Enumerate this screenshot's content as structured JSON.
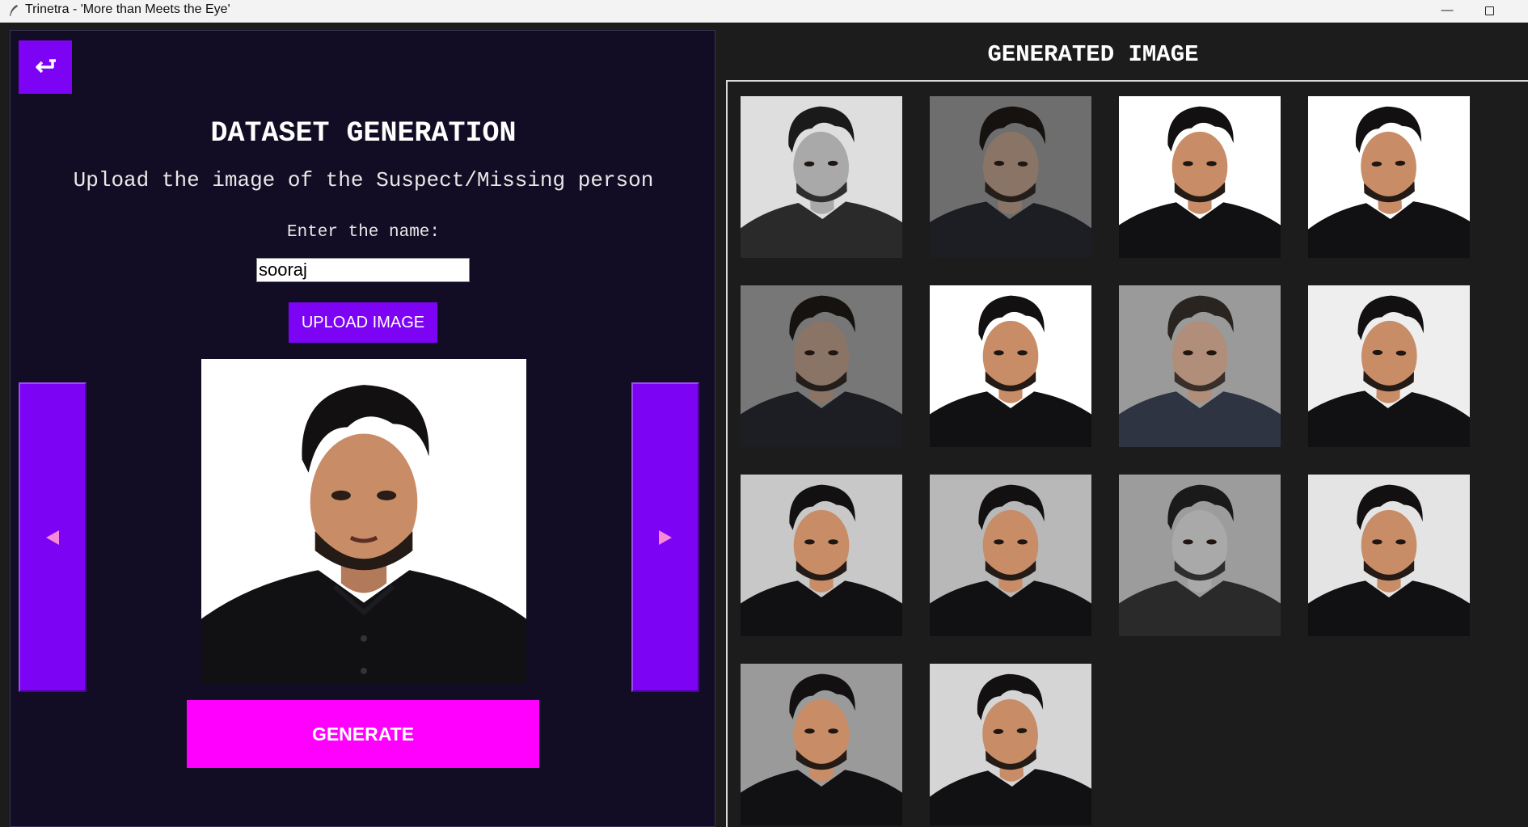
{
  "window": {
    "title": "Trinetra - 'More than Meets the Eye'",
    "minimize_glyph": "—"
  },
  "left": {
    "back_icon": "return-arrow-icon",
    "heading": "DATASET GENERATION",
    "subheading": "Upload the image of the Suspect/Missing person",
    "name_label": "Enter the name:",
    "name_value": "sooraj",
    "upload_label": "UPLOAD IMAGE",
    "generate_label": "GENERATE",
    "prev_icon": "triangle-left-icon",
    "next_icon": "triangle-right-icon"
  },
  "right": {
    "title": "GENERATED IMAGE",
    "thumbnails": [
      {
        "bg": "#dedede",
        "tone": "gray",
        "rot": -1.5
      },
      {
        "bg": "#6e6e6e",
        "tone": "dim",
        "rot": 1.5
      },
      {
        "bg": "#ffffff",
        "tone": "color",
        "rot": 0
      },
      {
        "bg": "#ffffff",
        "tone": "color",
        "rot": -2
      },
      {
        "bg": "#777777",
        "tone": "dim",
        "rot": 0
      },
      {
        "bg": "#ffffff",
        "tone": "color",
        "rot": 0
      },
      {
        "bg": "#9a9a9a",
        "tone": "muted",
        "rot": 0
      },
      {
        "bg": "#eeeeee",
        "tone": "color",
        "rot": 1.5
      },
      {
        "bg": "#c8c8c8",
        "tone": "color",
        "rot": 0
      },
      {
        "bg": "#b8b8b8",
        "tone": "color",
        "rot": 0
      },
      {
        "bg": "#9c9c9c",
        "tone": "gray",
        "rot": 0
      },
      {
        "bg": "#e4e4e4",
        "tone": "color",
        "rot": 0
      },
      {
        "bg": "#9a9a9a",
        "tone": "color",
        "rot": 0
      },
      {
        "bg": "#d5d5d5",
        "tone": "color",
        "rot": -2
      }
    ]
  },
  "colors": {
    "left_bg": "#120d24",
    "accent_purple": "#7d03f5",
    "generate_magenta": "#ff00ff",
    "arrow_glyph": "#f78ad6",
    "right_bg": "#1c1c1c"
  }
}
